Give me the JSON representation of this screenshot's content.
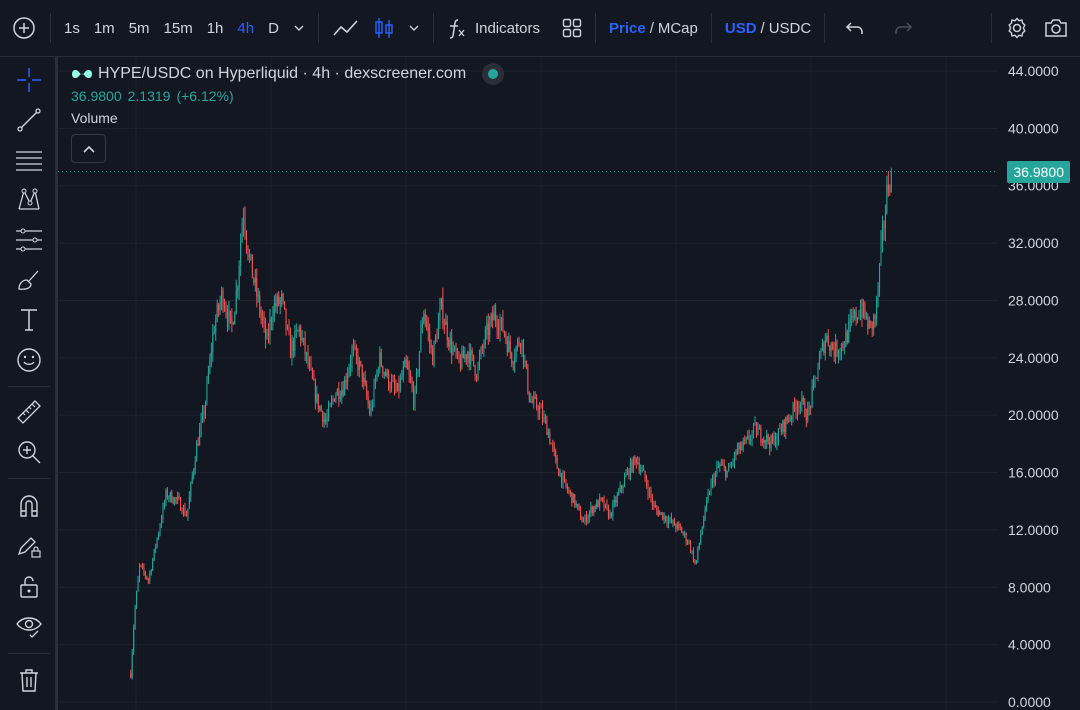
{
  "toolbar": {
    "intervals": [
      "1s",
      "1m",
      "5m",
      "15m",
      "1h",
      "4h",
      "D"
    ],
    "active_interval": "4h",
    "indicators_label": "Indicators",
    "price_label": "Price",
    "mcap_label": "MCap",
    "usd_label": "USD",
    "usdc_label": "USDC",
    "slash": "/"
  },
  "legend": {
    "title": "HYPE/USDC on Hyperliquid · 4h · dexscreener.com",
    "price": "36.9800",
    "change": "2.1319",
    "change_pct": "(+6.12%)",
    "volume_label": "Volume"
  },
  "colors": {
    "background": "#131722",
    "up": "#26a69a",
    "down": "#ef5350",
    "accent": "#2962ff",
    "grid": "#1e222d"
  },
  "chart_data": {
    "type": "candlestick",
    "pair": "HYPE/USDC",
    "timeframe": "4h",
    "y_ticks": [
      "44.0000",
      "40.0000",
      "36.0000",
      "32.0000",
      "28.0000",
      "24.0000",
      "20.0000",
      "16.0000",
      "12.0000",
      "8.0000",
      "4.0000",
      "0.0000"
    ],
    "ylim": [
      0,
      44
    ],
    "last_price": 36.98,
    "last_price_label": "36.9800",
    "grid": true,
    "trend_points": [
      [
        0,
        2.0
      ],
      [
        0.6,
        6.0
      ],
      [
        1.5,
        9.5
      ],
      [
        3,
        8.5
      ],
      [
        4.5,
        11.5
      ],
      [
        6,
        14.5
      ],
      [
        8,
        14
      ],
      [
        9.5,
        13
      ],
      [
        11,
        17.5
      ],
      [
        12.5,
        20.5
      ],
      [
        14,
        26
      ],
      [
        15.5,
        28.5
      ],
      [
        17,
        26
      ],
      [
        18,
        29
      ],
      [
        19,
        34.5
      ],
      [
        20,
        31
      ],
      [
        21.5,
        28
      ],
      [
        23,
        25
      ],
      [
        24,
        27.5
      ],
      [
        25.5,
        28
      ],
      [
        27,
        24.5
      ],
      [
        28.5,
        26
      ],
      [
        30,
        23.5
      ],
      [
        31.5,
        21
      ],
      [
        33,
        19.5
      ],
      [
        34.5,
        21.5
      ],
      [
        36,
        22
      ],
      [
        37.5,
        24.5
      ],
      [
        39,
        23
      ],
      [
        40.5,
        20
      ],
      [
        42,
        24
      ],
      [
        43.5,
        22.5
      ],
      [
        45,
        21.5
      ],
      [
        46.5,
        23.5
      ],
      [
        48,
        21
      ],
      [
        49.5,
        27.5
      ],
      [
        51,
        24
      ],
      [
        52.5,
        27.5
      ],
      [
        54,
        25
      ],
      [
        55.5,
        23.5
      ],
      [
        57,
        24.5
      ],
      [
        58.5,
        23
      ],
      [
        60,
        25.5
      ],
      [
        61.5,
        27
      ],
      [
        63,
        26
      ],
      [
        64.5,
        24
      ],
      [
        66,
        25.5
      ],
      [
        67.5,
        21
      ],
      [
        69,
        20.5
      ],
      [
        70.5,
        19
      ],
      [
        72,
        16.5
      ],
      [
        73.5,
        15
      ],
      [
        75,
        14
      ],
      [
        76.5,
        12.5
      ],
      [
        78,
        13.5
      ],
      [
        79.5,
        14
      ],
      [
        81,
        13
      ],
      [
        82.5,
        14.5
      ],
      [
        84,
        16
      ],
      [
        85.5,
        17
      ],
      [
        87,
        15.5
      ],
      [
        88.5,
        13.5
      ],
      [
        90,
        13
      ],
      [
        91.5,
        12.5
      ],
      [
        93,
        12
      ],
      [
        94.5,
        11
      ],
      [
        95.5,
        9.5
      ],
      [
        96.5,
        12
      ],
      [
        98,
        15
      ],
      [
        99.5,
        16.5
      ],
      [
        101,
        16
      ],
      [
        102.5,
        17.5
      ],
      [
        104,
        18
      ],
      [
        105.5,
        19
      ],
      [
        107,
        18.5
      ],
      [
        108.5,
        18
      ],
      [
        110,
        19
      ],
      [
        111.5,
        20
      ],
      [
        113,
        21
      ],
      [
        114.5,
        20
      ],
      [
        116,
        23
      ],
      [
        117.5,
        25.5
      ],
      [
        119,
        24.5
      ],
      [
        120.5,
        25
      ],
      [
        122,
        26.5
      ],
      [
        123.5,
        27.5
      ],
      [
        125,
        26
      ],
      [
        126,
        27
      ],
      [
        127,
        32
      ],
      [
        128,
        36
      ],
      [
        128.6,
        36.98
      ]
    ]
  }
}
